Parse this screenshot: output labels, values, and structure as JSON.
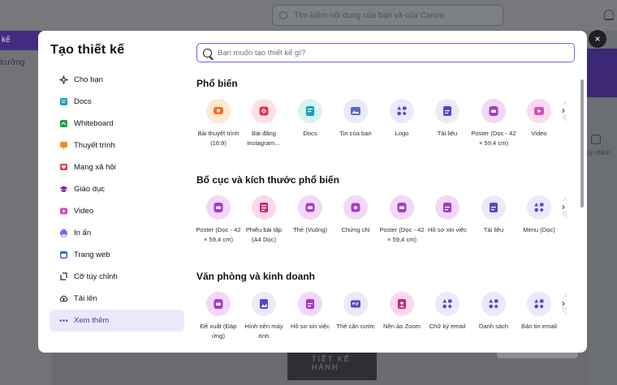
{
  "background": {
    "search_placeholder": "Tìm kiếm nội dung của bạn và của Canva",
    "left_label": "kế",
    "left_label2": "trưởng",
    "right_label": "tùy chỉnh",
    "dark_card": "TIẾT KẾ HÀNH"
  },
  "modal": {
    "title": "Tạo thiết kế",
    "close": "×",
    "search_placeholder": "Bạn muốn tạo thiết kế gì?",
    "menu": [
      {
        "label": "Cho bạn",
        "icon": "sparkles-icon",
        "color": "#1d1f22"
      },
      {
        "label": "Docs",
        "icon": "docs-icon",
        "color": "#13a3b5"
      },
      {
        "label": "Whiteboard",
        "icon": "whiteboard-icon",
        "color": "#15a34a"
      },
      {
        "label": "Thuyết trình",
        "icon": "presentation-icon",
        "color": "#f08a24"
      },
      {
        "label": "Mạng xã hội",
        "icon": "heart-icon",
        "color": "#e5334b"
      },
      {
        "label": "Giáo dục",
        "icon": "graduation-cap-icon",
        "color": "#7a2a8f"
      },
      {
        "label": "Video",
        "icon": "video-icon",
        "color": "#d94bbd"
      },
      {
        "label": "In ấn",
        "icon": "printer-icon",
        "color": "#8b5cf6"
      },
      {
        "label": "Trang web",
        "icon": "website-icon",
        "color": "#3b66d9"
      },
      {
        "label": "Cỡ tùy chỉnh",
        "icon": "custom-size-icon",
        "color": "#1d1f22"
      },
      {
        "label": "Tải lên",
        "icon": "upload-cloud-icon",
        "color": "#1d1f22"
      },
      {
        "label": "Xem thêm",
        "icon": "more-dots-icon",
        "color": "#4b31b8"
      }
    ],
    "sections": [
      {
        "title": "Phổ biến",
        "items": [
          {
            "label": "Bài thuyết trình (16:9)",
            "bg": "#fde9cf",
            "fg": "#f36f1f",
            "icon": "presentation-icon"
          },
          {
            "label": "Bài đăng Instagram…",
            "bg": "#fde0e3",
            "fg": "#e5334b",
            "icon": "instagram-icon"
          },
          {
            "label": "Docs",
            "bg": "#d7f3f6",
            "fg": "#13a3b5",
            "icon": "docs-icon"
          },
          {
            "label": "Tin của bạn",
            "bg": "#e8eaf6",
            "fg": "#5b67c4",
            "icon": "image-icon"
          },
          {
            "label": "Logo",
            "bg": "#ece9fa",
            "fg": "#5b44c7",
            "icon": "logo-shapes-icon"
          },
          {
            "label": "Tài liệu",
            "bg": "#ece9fa",
            "fg": "#5b44c7",
            "icon": "document-icon"
          },
          {
            "label": "Poster (Dọc - 42 × 59,4 cm)",
            "bg": "#f0d9f6",
            "fg": "#a43bc9",
            "icon": "poster-icon"
          },
          {
            "label": "Video",
            "bg": "#fbd9f0",
            "fg": "#d94bbd",
            "icon": "video-icon"
          }
        ]
      },
      {
        "title": "Bố cục và kích thước phổ biến",
        "items": [
          {
            "label": "Poster (Dọc - 42 × 59,4 cm)",
            "bg": "#f0d9f6",
            "fg": "#a43bc9",
            "icon": "poster-icon"
          },
          {
            "label": "Phiếu bài tập (A4 Dọc)",
            "bg": "#fbd9ea",
            "fg": "#c22a7a",
            "icon": "worksheet-icon"
          },
          {
            "label": "Thẻ (Vuông)",
            "bg": "#f0d9f6",
            "fg": "#a43bc9",
            "icon": "card-icon"
          },
          {
            "label": "Chứng chỉ",
            "bg": "#f0d9f6",
            "fg": "#a43bc9",
            "icon": "certificate-icon"
          },
          {
            "label": "Poster (Dọc - 42 × 59,4 cm)",
            "bg": "#f0d9f6",
            "fg": "#a43bc9",
            "icon": "poster-icon"
          },
          {
            "label": "Hồ sơ xin việc",
            "bg": "#f0d9f6",
            "fg": "#a43bc9",
            "icon": "resume-icon"
          },
          {
            "label": "Tài liệu",
            "bg": "#ece9fa",
            "fg": "#5b44c7",
            "icon": "document-icon"
          },
          {
            "label": "Menu (Dọc)",
            "bg": "#ece9fa",
            "fg": "#5b44c7",
            "icon": "menu-shapes-icon"
          }
        ]
      },
      {
        "title": "Văn phòng và kinh doanh",
        "items": [
          {
            "label": "Đề xuất (Đáp ứng)",
            "bg": "#f0d9f6",
            "fg": "#a43bc9",
            "icon": "proposal-icon"
          },
          {
            "label": "Hình nền máy tính",
            "bg": "#ece9fa",
            "fg": "#5b44c7",
            "icon": "wallpaper-icon"
          },
          {
            "label": "Hồ sơ xin việc",
            "bg": "#f0d9f6",
            "fg": "#a43bc9",
            "icon": "resume-icon"
          },
          {
            "label": "Thẻ căn cước",
            "bg": "#ece9fa",
            "fg": "#5b44c7",
            "icon": "id-card-icon"
          },
          {
            "label": "Nền ảo Zoom",
            "bg": "#fbd9ea",
            "fg": "#c22a7a",
            "icon": "zoom-background-icon"
          },
          {
            "label": "Chữ ký email",
            "bg": "#ece9fa",
            "fg": "#5b44c7",
            "icon": "email-signature-icon"
          },
          {
            "label": "Danh sách",
            "bg": "#ece9fa",
            "fg": "#5b44c7",
            "icon": "list-shapes-icon"
          },
          {
            "label": "Bản tin email",
            "bg": "#ece9fa",
            "fg": "#5b44c7",
            "icon": "newsletter-icon"
          }
        ]
      }
    ],
    "next_arrow": "›"
  }
}
